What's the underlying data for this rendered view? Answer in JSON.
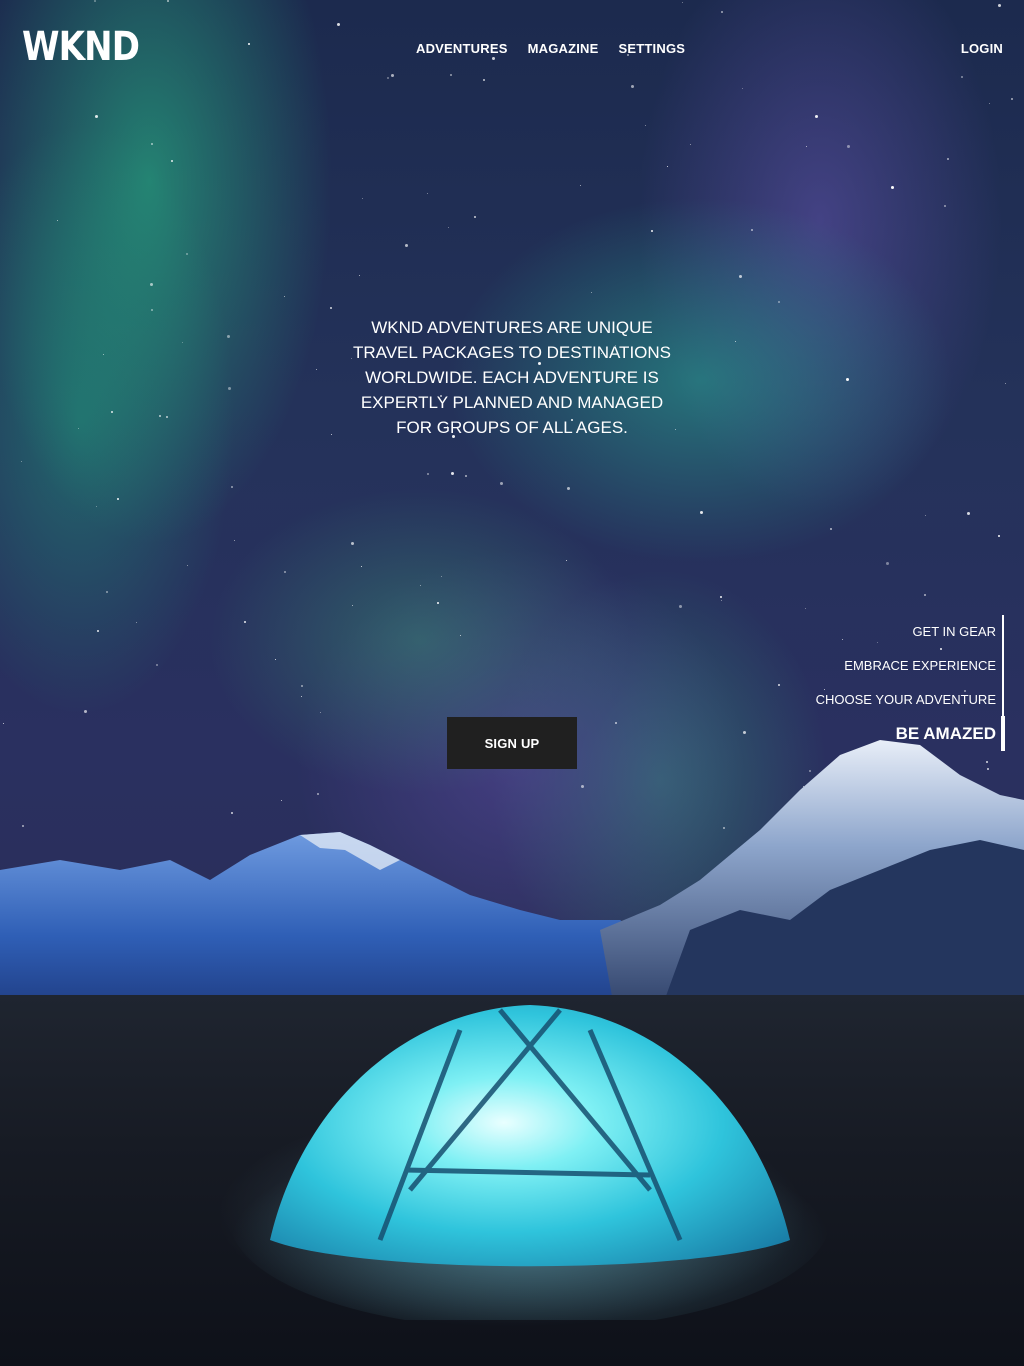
{
  "header": {
    "logo": "WKND",
    "nav": [
      {
        "label": "ADVENTURES"
      },
      {
        "label": "MAGAZINE"
      },
      {
        "label": "SETTINGS"
      }
    ],
    "login_label": "LOGIN"
  },
  "hero": {
    "text": "WKND ADVENTURES ARE UNIQUE TRAVEL PACKAGES TO DESTINATIONS WORLDWIDE. EACH ADVENTURE IS EXPERTLY PLANNED AND MANAGED FOR GROUPS OF ALL AGES.",
    "signup_label": "SIGN UP"
  },
  "carousel": {
    "items": [
      {
        "label": "GET IN GEAR"
      },
      {
        "label": "EMBRACE EXPERIENCE"
      },
      {
        "label": "CHOOSE YOUR ADVENTURE"
      },
      {
        "label": "BE AMAZED"
      }
    ],
    "active_index": 3
  },
  "colors": {
    "button_bg": "#202020",
    "text": "#ffffff",
    "aurora_green": "#28c88c",
    "aurora_purple": "#6e5abe",
    "tent_cyan": "#3fd6e6"
  },
  "background_image": "aurora-night-camping-tent-mountains"
}
